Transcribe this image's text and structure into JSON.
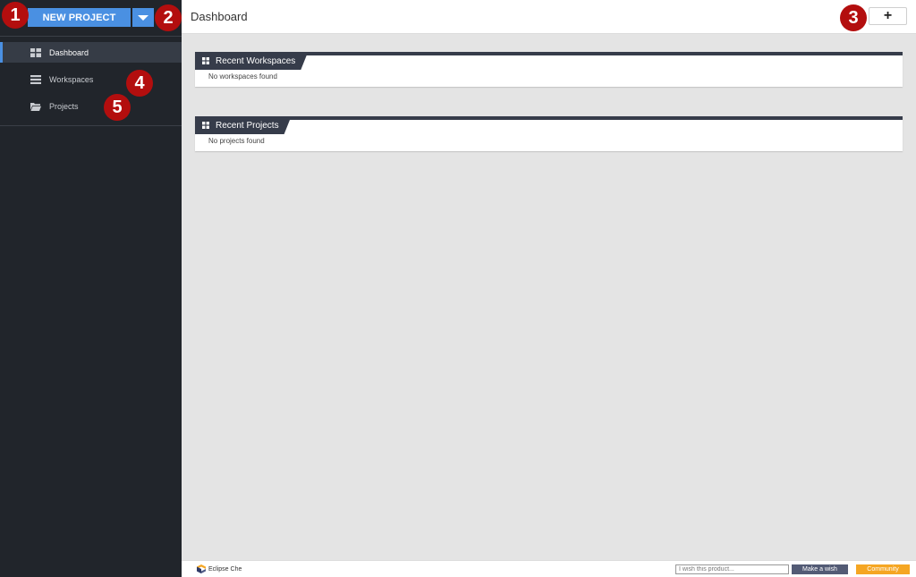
{
  "sidebar": {
    "new_project_label": "NEW PROJECT",
    "items": [
      {
        "label": "Dashboard",
        "icon": "dashboard-icon",
        "active": true
      },
      {
        "label": "Workspaces",
        "icon": "workspaces-icon",
        "active": false
      },
      {
        "label": "Projects",
        "icon": "folder-icon",
        "active": false
      }
    ]
  },
  "header": {
    "title": "Dashboard",
    "add_label": "+"
  },
  "panels": {
    "workspaces": {
      "title": "Recent Workspaces",
      "empty_text": "No workspaces found"
    },
    "projects": {
      "title": "Recent Projects",
      "empty_text": "No projects found"
    }
  },
  "footer": {
    "logo_text": "Eclipse Che",
    "wish_placeholder": "I wish this product...",
    "wish_button": "Make a wish",
    "community_button": "Community"
  },
  "annotations": [
    "1",
    "2",
    "3",
    "4",
    "5"
  ],
  "colors": {
    "sidebar_bg": "#21252b",
    "accent": "#4a90e2",
    "badge": "#b30e0e",
    "panel_header": "#363c4a",
    "community": "#f5a623"
  }
}
